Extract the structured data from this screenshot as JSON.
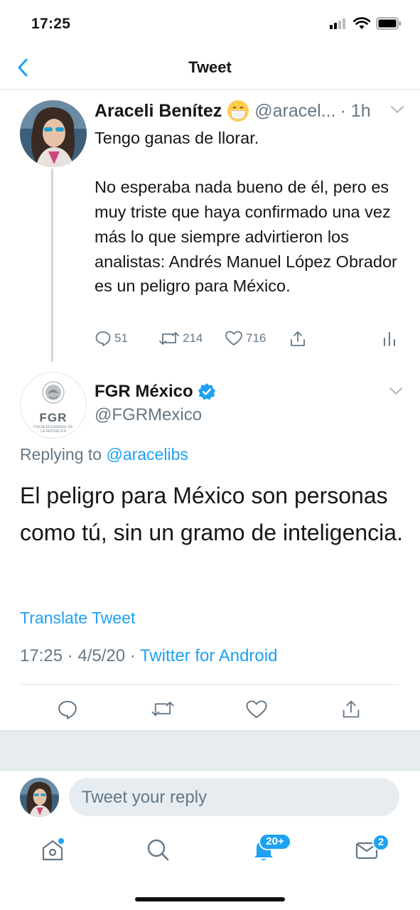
{
  "status_bar": {
    "time": "17:25"
  },
  "nav": {
    "title": "Tweet"
  },
  "parent_tweet": {
    "name": "Araceli Benítez",
    "handle": "@aracel...",
    "time": "· 1h",
    "text": "Tengo ganas de llorar.\n\nNo esperaba nada bueno de él, pero es muy triste que haya confirmado una vez más lo que siempre advirtieron los analistas: Andrés Manuel López Obrador es un peligro para México.",
    "reply_count": "51",
    "retweet_count": "214",
    "like_count": "716"
  },
  "main_tweet": {
    "name": "FGR México",
    "handle": "@FGRMexico",
    "avatar_text": "FGR",
    "avatar_subtext": "FISCALÍA GENERAL DE LA REPÚBLICA",
    "replying_prefix": "Replying to",
    "replying_handle": "@aracelibs",
    "text": "El peligro para México son personas como tú, sin un gramo de inteligencia.",
    "translate_label": "Translate Tweet",
    "timestamp": "17:25 · 4/5/20 · ",
    "source": "Twitter for Android"
  },
  "reply_bar": {
    "placeholder": "Tweet your reply"
  },
  "tabbar": {
    "notifications_badge": "20+",
    "messages_badge": "2"
  },
  "colors": {
    "accent": "#1da1f2",
    "secondary_text": "#657786",
    "divider": "#e1e8ed",
    "band": "#e6ecf0"
  },
  "icons": [
    "back-chevron-icon",
    "emoji-mask-icon",
    "chevron-down-icon",
    "verified-badge-icon",
    "reply-icon",
    "retweet-icon",
    "like-icon",
    "share-icon",
    "analytics-icon",
    "home-icon",
    "search-icon",
    "notifications-icon",
    "messages-icon"
  ]
}
